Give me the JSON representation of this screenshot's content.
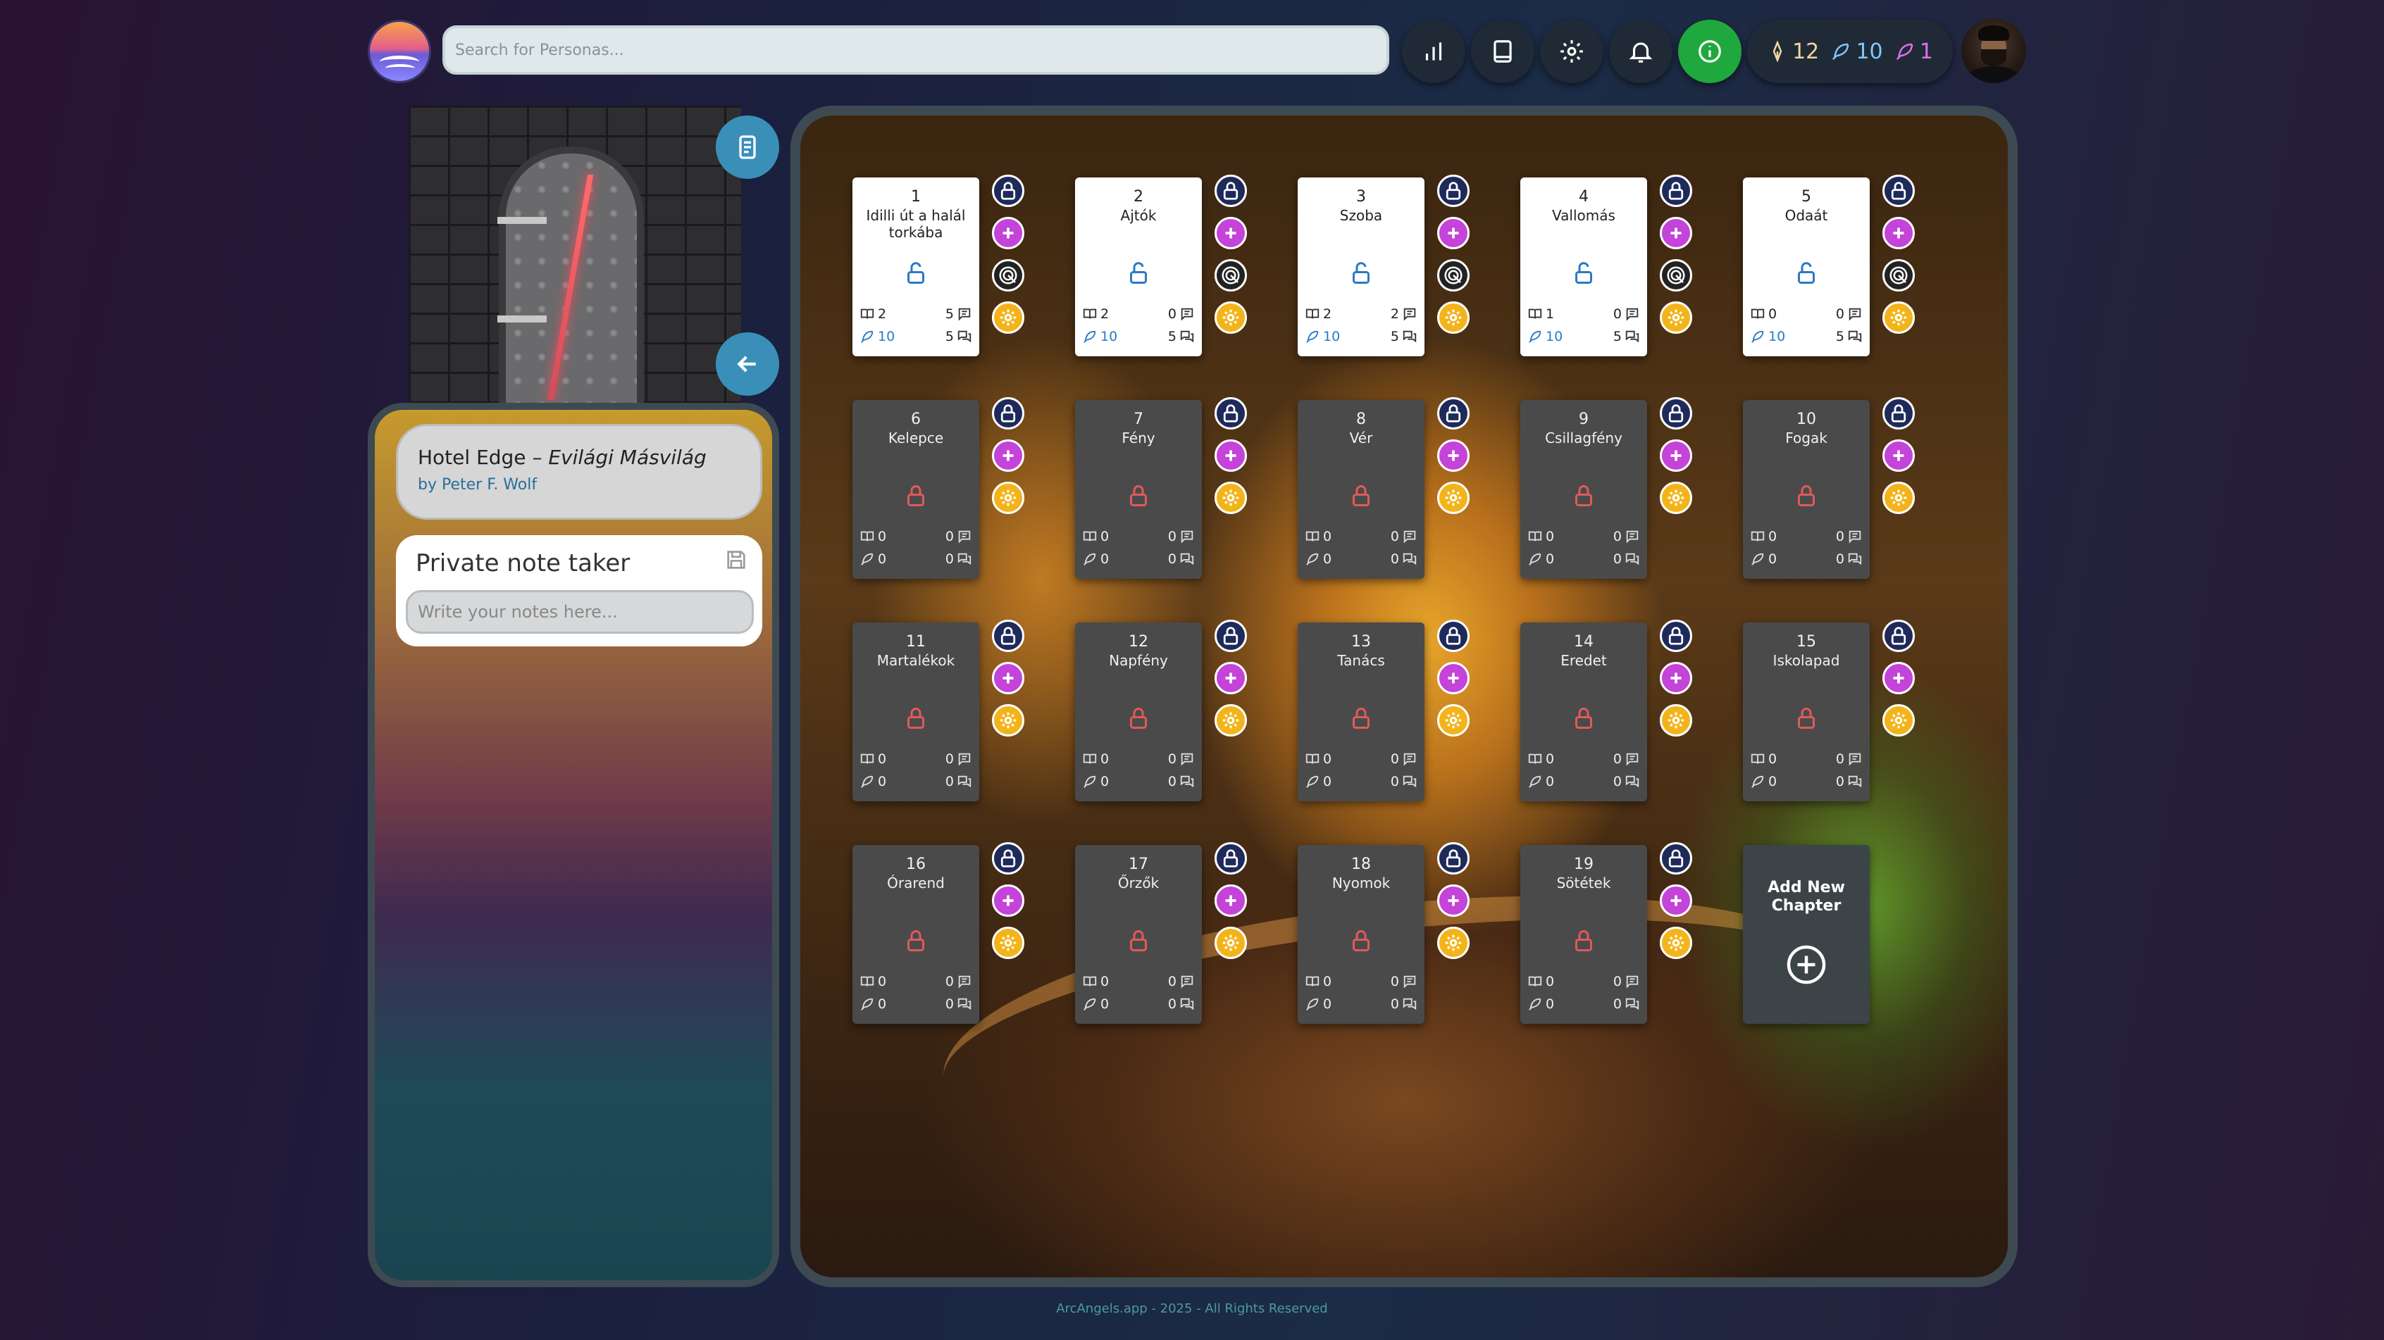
{
  "header": {
    "search_placeholder": "Search for Personas...",
    "counters": [
      {
        "icon": "pen-nib-icon",
        "value": "12",
        "color": "#f0d6a0"
      },
      {
        "icon": "feather-icon",
        "value": "10",
        "color": "#7ec8ff"
      },
      {
        "icon": "feather-icon",
        "value": "1",
        "color": "#e070f0"
      }
    ]
  },
  "book": {
    "title": "Hotel Edge",
    "separator": " – ",
    "subtitle": "Evilági Másvilág",
    "author": "by Peter F. Wolf"
  },
  "notes": {
    "title": "Private note taker",
    "placeholder": "Write your notes here..."
  },
  "chapters": [
    {
      "num": "1",
      "name": "Idilli út a halál torkába",
      "open": true,
      "a": "2",
      "b": "5",
      "c": "10",
      "d": "5"
    },
    {
      "num": "2",
      "name": "Ajtók",
      "open": true,
      "a": "2",
      "b": "0",
      "c": "10",
      "d": "5"
    },
    {
      "num": "3",
      "name": "Szoba",
      "open": true,
      "a": "2",
      "b": "2",
      "c": "10",
      "d": "5"
    },
    {
      "num": "4",
      "name": "Vallomás",
      "open": true,
      "a": "1",
      "b": "0",
      "c": "10",
      "d": "5"
    },
    {
      "num": "5",
      "name": "Odaát",
      "open": true,
      "a": "0",
      "b": "0",
      "c": "10",
      "d": "5"
    },
    {
      "num": "6",
      "name": "Kelepce",
      "open": false,
      "a": "0",
      "b": "0",
      "c": "0",
      "d": "0"
    },
    {
      "num": "7",
      "name": "Fény",
      "open": false,
      "a": "0",
      "b": "0",
      "c": "0",
      "d": "0"
    },
    {
      "num": "8",
      "name": "Vér",
      "open": false,
      "a": "0",
      "b": "0",
      "c": "0",
      "d": "0"
    },
    {
      "num": "9",
      "name": "Csillagfény",
      "open": false,
      "a": "0",
      "b": "0",
      "c": "0",
      "d": "0"
    },
    {
      "num": "10",
      "name": "Fogak",
      "open": false,
      "a": "0",
      "b": "0",
      "c": "0",
      "d": "0"
    },
    {
      "num": "11",
      "name": "Martalékok",
      "open": false,
      "a": "0",
      "b": "0",
      "c": "0",
      "d": "0"
    },
    {
      "num": "12",
      "name": "Napfény",
      "open": false,
      "a": "0",
      "b": "0",
      "c": "0",
      "d": "0"
    },
    {
      "num": "13",
      "name": "Tanács",
      "open": false,
      "a": "0",
      "b": "0",
      "c": "0",
      "d": "0"
    },
    {
      "num": "14",
      "name": "Eredet",
      "open": false,
      "a": "0",
      "b": "0",
      "c": "0",
      "d": "0"
    },
    {
      "num": "15",
      "name": "Iskolapad",
      "open": false,
      "a": "0",
      "b": "0",
      "c": "0",
      "d": "0"
    },
    {
      "num": "16",
      "name": "Órarend",
      "open": false,
      "a": "0",
      "b": "0",
      "c": "0",
      "d": "0"
    },
    {
      "num": "17",
      "name": "Őrzők",
      "open": false,
      "a": "0",
      "b": "0",
      "c": "0",
      "d": "0"
    },
    {
      "num": "18",
      "name": "Nyomok",
      "open": false,
      "a": "0",
      "b": "0",
      "c": "0",
      "d": "0"
    },
    {
      "num": "19",
      "name": "Sötétek",
      "open": false,
      "a": "0",
      "b": "0",
      "c": "0",
      "d": "0"
    }
  ],
  "add_chapter": {
    "line1": "Add New",
    "line2": "Chapter"
  },
  "footer": {
    "text": "ArcAngels.app - 2025 - All Rights Reserved"
  },
  "colors": {
    "lock_open": "#2a7ac4",
    "lock_closed": "#e05a5a",
    "add": "#c443d8",
    "gear": "#f3b41b",
    "info": "#1fa83e"
  }
}
